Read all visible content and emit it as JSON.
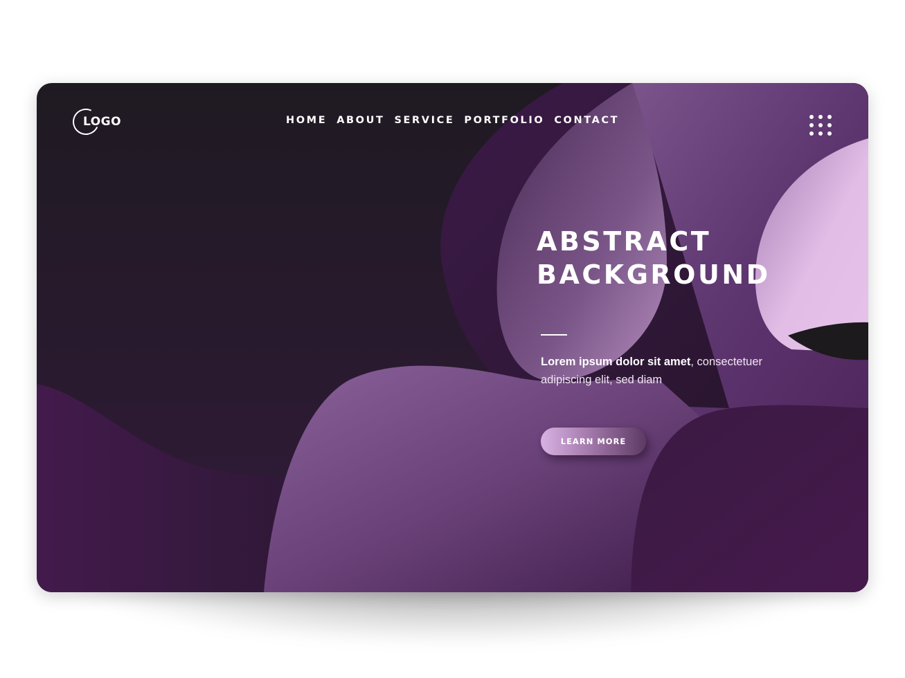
{
  "logo": {
    "text": "LOGO"
  },
  "nav": {
    "items": [
      {
        "label": "HOME"
      },
      {
        "label": "ABOUT"
      },
      {
        "label": "SERVICE"
      },
      {
        "label": "PORTFOLIO"
      },
      {
        "label": "CONTACT"
      }
    ]
  },
  "menu": {
    "icon": "grid-dots-icon"
  },
  "hero": {
    "title_line1": "ABSTRACT",
    "title_line2": "BACKGROUND",
    "text_bold": "Lorem ipsum dolor sit amet",
    "text_rest": ", consectetuer adipiscing elit, sed diam",
    "cta_label": "LEARN MORE"
  },
  "colors": {
    "dark": "#1f1a22",
    "deep_purple": "#3f1b47",
    "mid_purple": "#7e5690",
    "light_lilac": "#e2bde6",
    "white": "#ffffff"
  }
}
